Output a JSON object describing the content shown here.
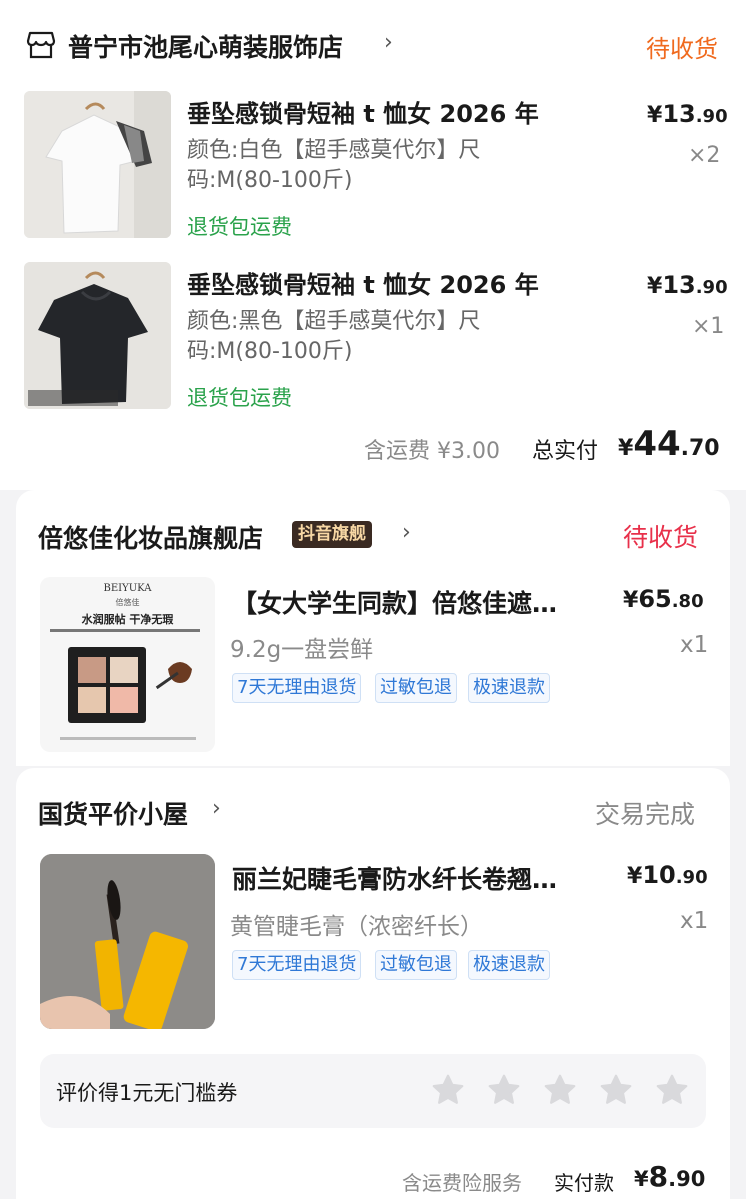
{
  "order1": {
    "store": "普宁市池尾心萌装服饰店",
    "status": "待收货",
    "items": [
      {
        "title": "垂坠感锁骨短袖 t 恤女 2026 年",
        "spec_line1": "颜色:白色【超手感莫代尔】尺",
        "spec_line2": "码:M(80-100斤)",
        "service": "退货包运费",
        "price_symbol": "¥",
        "price_int": "13",
        "price_dec": ".90",
        "qty": "×2"
      },
      {
        "title": "垂坠感锁骨短袖 t 恤女 2026 年",
        "spec_line1": "颜色:黑色【超手感莫代尔】尺",
        "spec_line2": "码:M(80-100斤)",
        "service": "退货包运费",
        "price_symbol": "¥",
        "price_int": "13",
        "price_dec": ".90",
        "qty": "×1"
      }
    ],
    "shipping_text": "含运费 ¥3.00",
    "total_label": "总实付",
    "total_symbol": "¥",
    "total_int": "44",
    "total_dec": ".70"
  },
  "order2": {
    "store": "倍悠佳化妆品旗舰店",
    "badge": "抖音旗舰",
    "status": "待收货",
    "title": "【女大学生同款】倍悠佳遮…",
    "spec": "9.2g一盘尝鲜",
    "price_symbol": "¥",
    "price_int": "65",
    "price_dec": ".80",
    "qty": "x1",
    "tags": [
      "7天无理由退货",
      "过敏包退",
      "极速退款"
    ],
    "thumb": {
      "brand": "BEIYUKA",
      "brand_cn": "倍悠佳",
      "headline": "水润服帖  干净无瑕"
    }
  },
  "order3": {
    "store": "国货平价小屋",
    "status": "交易完成",
    "title": "丽兰妃睫毛膏防水纤长卷翘…",
    "spec": "黄管睫毛膏（浓密纤长）",
    "price_symbol": "¥",
    "price_int": "10",
    "price_dec": ".90",
    "qty": "x1",
    "tags": [
      "7天无理由退货",
      "过敏包退",
      "极速退款"
    ],
    "rating_prompt": "评价得1元无门槛券",
    "footer_service": "含运费险服务",
    "footer_label": "实付款",
    "footer_symbol": "¥",
    "footer_int": "8",
    "footer_dec": ".90"
  },
  "colors": {
    "orange_status": "#f06a1e",
    "red_status": "#e8304a",
    "green_service": "#2aa24b",
    "tag_blue": "#2f78d6"
  }
}
